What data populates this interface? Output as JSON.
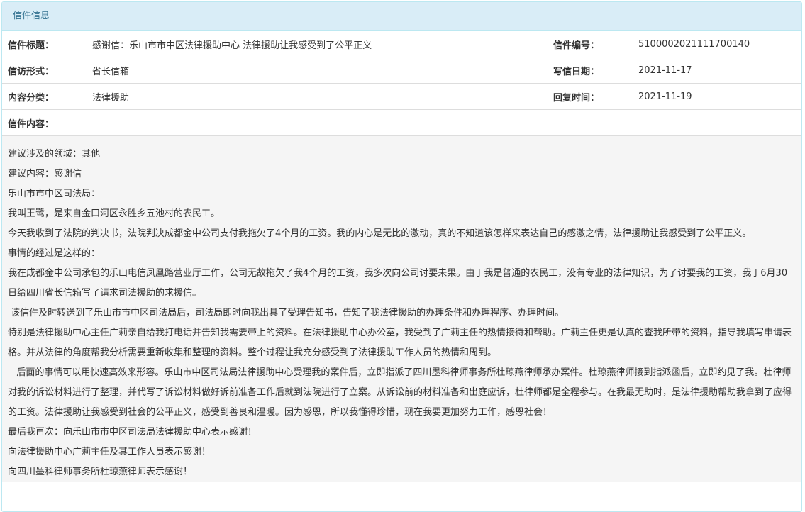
{
  "panel": {
    "title": "信件信息"
  },
  "fields": {
    "title_label": "信件标题：",
    "title_value": "感谢信：乐山市市中区法律援助中心 法律援助让我感受到了公平正义",
    "number_label": "信件编号：",
    "number_value": "5100002021111700140",
    "form_label": "信访形式：",
    "form_value": "省长信箱",
    "date_label": "写信日期：",
    "date_value": "2021-11-17",
    "category_label": "内容分类：",
    "category_value": "法律援助",
    "reply_label": "回复时间：",
    "reply_value": "2021-11-19",
    "content_label": "信件内容："
  },
  "content": {
    "paragraphs": [
      "建议涉及的领域：其他",
      "建议内容：感谢信",
      "乐山市市中区司法局：",
      "我叫王鹭，是来自金口河区永胜乡五池村的农民工。",
      "今天我收到了法院的判决书，法院判决成都金中公司支付我拖欠了4个月的工资。我的内心是无比的激动，真的不知道该怎样来表达自己的感激之情，法律援助让我感受到了公平正义。",
      "事情的经过是这样的：",
      "我在成都金中公司承包的乐山电信凤凰路营业厅工作，公司无故拖欠了我4个月的工资，我多次向公司讨要未果。由于我是普通的农民工，没有专业的法律知识，为了讨要我的工资，我于6月30日给四川省长信箱写了请求司法援助的求援信。",
      " 该信件及时转送到了乐山市市中区司法局后，司法局即时向我出具了受理告知书，告知了我法律援助的办理条件和办理程序、办理时间。",
      "特别是法律援助中心主任广莉亲自给我打电话并告知我需要带上的资料。在法律援助中心办公室，我受到了广莉主任的热情接待和帮助。广莉主任更是认真的查我所带的资料，指导我填写申请表格。并从法律的角度帮我分析需要重新收集和整理的资料。整个过程让我充分感受到了法律援助工作人员的热情和周到。",
      "   后面的事情可以用快速高效来形容。乐山市中区司法局法律援助中心受理我的案件后，立即指派了四川墨科律师事务所杜琼燕律师承办案件。杜琼燕律师接到指派函后，立即约见了我。杜律师对我的诉讼材料进行了整理，并代写了诉讼材料做好诉前准备工作后就到法院进行了立案。从诉讼前的材料准备和出庭应诉，杜律师都是全程参与。在我最无助时，是法律援助帮助我拿到了应得的工资。法律援助让我感受到社会的公平正义，感受到善良和温暖。因为感恩，所以我懂得珍惜，现在我要更加努力工作，感恩社会！",
      "最后我再次：向乐山市市中区司法局法律援助中心表示感谢！",
      "向法律援助中心广莉主任及其工作人员表示感谢！",
      "向四川墨科律师事务所杜琼燕律师表示感谢！"
    ]
  },
  "colors": {
    "heading_bg": "#d9edf7",
    "heading_text": "#31708f",
    "border": "#bce8f1",
    "content_bg": "#f5f5f5"
  }
}
